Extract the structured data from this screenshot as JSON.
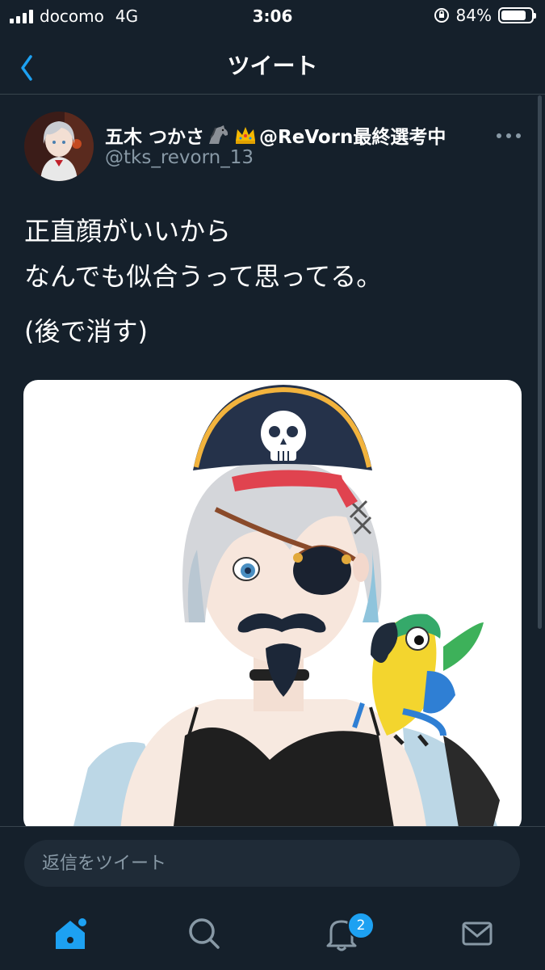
{
  "status_bar": {
    "carrier": "docomo",
    "network": "4G",
    "time": "3:06",
    "battery_percent": "84%",
    "battery_level": 0.84
  },
  "nav": {
    "title": "ツイート",
    "back_icon": "chevron-left-icon"
  },
  "tweet": {
    "author_name": "五木 つかさ",
    "author_suffix": "@ReVorn最終選考中",
    "author_emojis": [
      "horse-emoji",
      "crown-emoji"
    ],
    "handle": "@tks_revorn_13",
    "more_icon": "more-dots-icon",
    "text_line1": "正直顔がいいから",
    "text_line2": "なんでも似合うって思ってる。",
    "text_line3": "(後で消す)",
    "image_description_icon": "illustration-image"
  },
  "reply": {
    "placeholder": "返信をツイート"
  },
  "tabs": {
    "items": [
      "home-icon",
      "search-icon",
      "bell-icon",
      "mail-icon"
    ],
    "notification_count": "2"
  },
  "colors": {
    "background": "#15202b",
    "accent": "#1da1f2",
    "secondary_text": "#8899a6",
    "divider": "#38444d"
  }
}
